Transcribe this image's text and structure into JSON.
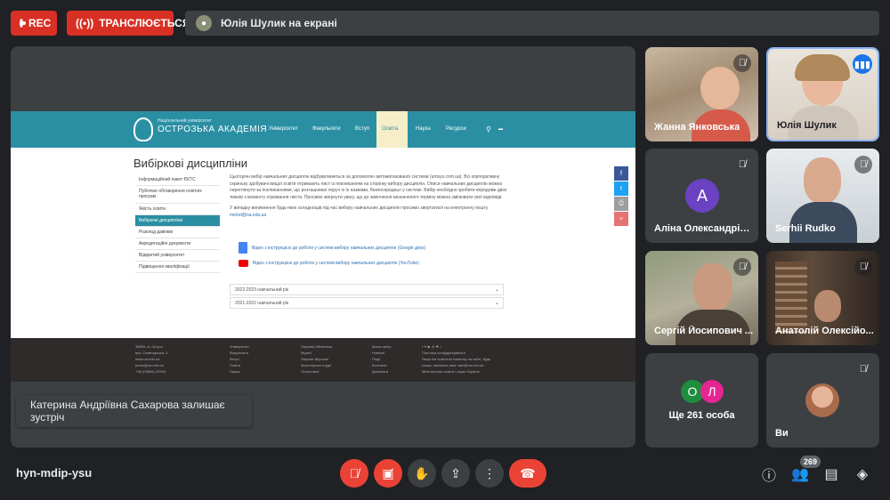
{
  "topbar": {
    "rec_label": "REC",
    "live_label": "ТРАНСЛЮЄТЬСЯ",
    "presenter_text": "Юлія Шулик на екрані"
  },
  "site": {
    "logo_small": "Національний університет",
    "logo_name": "ОСТРОЗЬКА АКАДЕМІЯ",
    "nav": [
      "Університет",
      "Факультети",
      "Вступ",
      "Освіта",
      "Наука",
      "Ресурси"
    ],
    "active_nav": "Освіта",
    "page_title": "Вибіркові дисципліни",
    "side_menu": [
      "Інформаційний пакет ЄКТС",
      "Публічне обговорення освітніх програм",
      "Якість освіти",
      "Вибіркові дисципліни",
      "Розклад дзвінків",
      "Акредитаційні документи",
      "Відкритий університет",
      "Підвищення кваліфікації"
    ],
    "paragraph1": "Цьогорічн вибір навчальних дисциплін відбуватиметься за допомогою автоматизованої системи (umsys.com.ua). Всі корпоративну скриньку здобувачі вищої освіти отримають лист із покликанням на сторінку вибору дисциплін. Описи навчальних дисциплін можна переглянути за покликаннями, що розташовані поруч із їх назвами, безпосередньо у системі. Вибір необхідно зробити впродовж двох тижнів з моменту отримання листа. Просимо звернути увагу, що до закінчення визначеного терміну можна змінювати свої відповіді.",
    "paragraph2": "У випадку виникнення будь-яких складнощів під час вибору навчальних дисциплін просимо звертатися на електронну пошту",
    "email": "metod@oa.edu.ua",
    "video1": "Відео з інструкцією до роботи у системі вибору навчальних дисциплін (Google диск)",
    "video2": "Відео з інструкцією до роботи у системі вибору навчальних дисциплін (YouTube)",
    "years": [
      "2022-2023 навчальний рік",
      "2021-2022 навчальний рік"
    ],
    "footer_address": [
      "35800, м. Острог",
      "вул. Семінарська, 2",
      "www.oa.edu.ua",
      "press@oa.edu.ua",
      "+38 (03654) 22949"
    ],
    "footer_col2": [
      "Університет",
      "Факультети",
      "Вступ",
      "Освіта",
      "Наука"
    ],
    "footer_col3": [
      "Наукова бібліотека",
      "Музей",
      "Наукові збірники",
      "Магістерські студії",
      "Острогіана"
    ],
    "footer_col4": [
      "Мапа сайту",
      "Новини",
      "Події",
      "Контакти",
      "Допомога"
    ],
    "footer_col5": [
      "Політика конфіденційності",
      "Якщо Ви помітили помилку на сайті, будь",
      "ласка, напишіть нам: web@oa.edu.ua",
      "Міністерство освіти і науки України"
    ]
  },
  "toast": "Катерина Андріївна Сахарова залишає зустріч",
  "participants": [
    {
      "name": "Жанна Янковська"
    },
    {
      "name": "Юлія Шулик"
    },
    {
      "name": "Аліна Олександрів...",
      "initial": "А"
    },
    {
      "name": "Serhii Rudko"
    },
    {
      "name": "Сергій Йосипович ..."
    },
    {
      "name": "Анатолій Олексійо..."
    },
    {
      "name": "Ще 261 особа",
      "initials": [
        "О",
        "Л"
      ]
    },
    {
      "name": "Ви"
    }
  ],
  "bottom": {
    "meeting_code": "hyn-mdip-ysu",
    "people_count": "269"
  },
  "colors": {
    "record_red": "#d93025",
    "site_teal": "#2a8fa3",
    "avatar_purple": "#6a42c2",
    "avatar_green": "#1e8e3e",
    "avatar_pink": "#e52592",
    "end_call_red": "#ea4335",
    "speaking_blue": "#1a73e8"
  },
  "icons": [
    "record-icon",
    "broadcast-icon",
    "mic-off-icon",
    "camera-off-icon",
    "raise-hand-icon",
    "present-icon",
    "more-options-icon",
    "end-call-icon",
    "info-icon",
    "people-icon",
    "chat-icon",
    "activities-icon",
    "speaking-icon"
  ]
}
